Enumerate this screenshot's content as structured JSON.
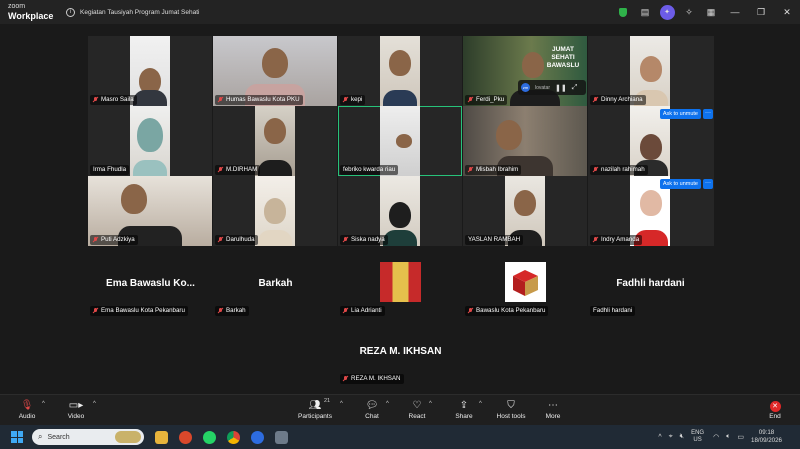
{
  "titlebar": {
    "logo_line1": "zoom",
    "logo_line2": "Workplace",
    "meeting_title": "Kegiatan Tausiyah Program Jumat Sehati",
    "avatar_initial": "✦"
  },
  "grid_tiles": [
    {
      "name": "Masro Saila"
    },
    {
      "name": "Humas Bawaslu Kota PKU"
    },
    {
      "name": "kepi"
    },
    {
      "name": "Ferdi_Pku",
      "banner": "JUMAT SEHATI BAWASLU"
    },
    {
      "name": "Dinny Archiana"
    },
    {
      "name": "Irma Fhudla"
    },
    {
      "name": "M.DIRHAM"
    },
    {
      "name": "febriko kwarda riau"
    },
    {
      "name": "Misbah Ibrahim"
    },
    {
      "name": "nazilah rahimah"
    },
    {
      "name": "Puti Adzkiya"
    },
    {
      "name": "Darulhuda"
    },
    {
      "name": "Siska nadya"
    },
    {
      "name": "YASLAN RAMBAH"
    },
    {
      "name": "Indry Amanda"
    }
  ],
  "ask_to_unmute": "Ask to unmute",
  "more_label": "···",
  "float_bar_text": "lovatar",
  "lower_tiles": [
    {
      "display": "Ema Bawaslu Ko...",
      "name": "Ema Bawaslu Kota Pekanbaru"
    },
    {
      "display": "Barkah",
      "name": "Barkah"
    },
    {
      "display": "",
      "name": "Lia Adrianti"
    },
    {
      "display": "",
      "name": "Bawaslu Kota Pekanbaru"
    },
    {
      "display": "Fadhli hardani",
      "name": "Fadhli hardani"
    },
    {
      "display": "REZA M. IKHSAN",
      "name": "REZA M. IKHSAN"
    }
  ],
  "toolbar": {
    "audio": "Audio",
    "video": "Video",
    "participants": "Participants",
    "participants_count": "21",
    "chat": "Chat",
    "react": "React",
    "share": "Share",
    "host_tools": "Host tools",
    "more": "More",
    "end": "End"
  },
  "taskbar": {
    "search_placeholder": "Search",
    "lang_line1": "ENG",
    "lang_line2": "US",
    "time": "09:18",
    "date": "18/09/2026"
  },
  "colors": {
    "accent": "#0e72ed",
    "speaking": "#27c27a",
    "muted": "#e04848",
    "end": "#e02828"
  }
}
